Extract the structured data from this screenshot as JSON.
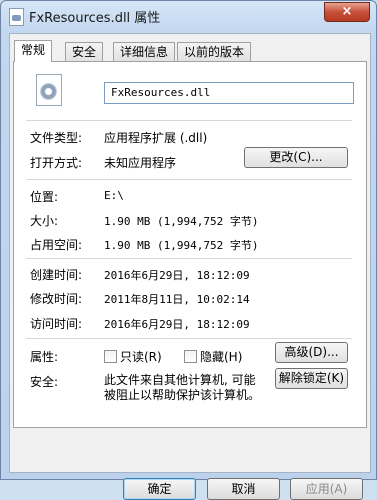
{
  "window": {
    "title": "FxResources.dll 属性",
    "close_label": "×"
  },
  "tabs": [
    {
      "label": "常规"
    },
    {
      "label": "安全"
    },
    {
      "label": "详细信息"
    },
    {
      "label": "以前的版本"
    }
  ],
  "general": {
    "file_name": "FxResources.dll",
    "file_type_label": "文件类型:",
    "file_type_value": "应用程序扩展 (.dll)",
    "opens_with_label": "打开方式:",
    "opens_with_value": "未知应用程序",
    "change_button": "更改(C)...",
    "location_label": "位置:",
    "location_value": "E:\\",
    "size_label": "大小:",
    "size_value": "1.90 MB (1,994,752 字节)",
    "size_on_disk_label": "占用空间:",
    "size_on_disk_value": "1.90 MB (1,994,752 字节)",
    "created_label": "创建时间:",
    "created_value": "2016年6月29日, 18:12:09",
    "modified_label": "修改时间:",
    "modified_value": "2011年8月11日, 10:02:14",
    "accessed_label": "访问时间:",
    "accessed_value": "2016年6月29日, 18:12:09",
    "attributes_label": "属性:",
    "readonly_label": "只读(R)",
    "hidden_label": "隐藏(H)",
    "advanced_button": "高级(D)...",
    "security_label": "安全:",
    "security_text_line1": "此文件来自其他计算机, 可能",
    "security_text_line2": "被阻止以帮助保护该计算机。",
    "unblock_button": "解除锁定(K)"
  },
  "footer": {
    "ok": "确定",
    "cancel": "取消",
    "apply": "应用(A)"
  }
}
